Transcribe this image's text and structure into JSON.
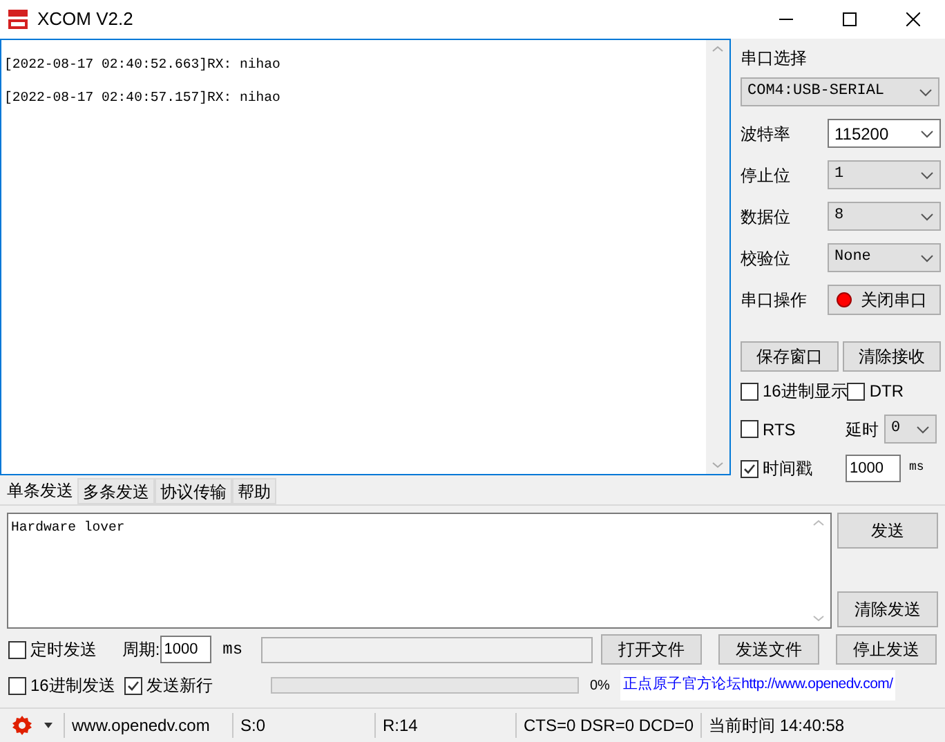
{
  "window": {
    "title": "XCOM V2.2"
  },
  "receive": {
    "lines": [
      "[2022-08-17 02:40:52.663]RX: nihao",
      "[2022-08-17 02:40:57.157]RX: nihao"
    ]
  },
  "port_panel": {
    "port_label": "串口选择",
    "port_value": "COM4:USB-SERIAL",
    "settings": [
      {
        "label": "波特率",
        "value": "115200",
        "kind": "combo"
      },
      {
        "label": "停止位",
        "value": "1",
        "kind": "select"
      },
      {
        "label": "数据位",
        "value": "8",
        "kind": "select"
      },
      {
        "label": "校验位",
        "value": "None",
        "kind": "select"
      }
    ],
    "operation_label": "串口操作",
    "operation_button": "关闭串口",
    "port_open": true,
    "buttons": [
      "保存窗口",
      "清除接收"
    ],
    "hex_display": {
      "label": "16进制显示",
      "checked": false
    },
    "dtr": {
      "label": "DTR",
      "checked": false
    },
    "rts": {
      "label": "RTS",
      "checked": false
    },
    "delay_label": "延时",
    "delay_value": "0",
    "timestamp": {
      "label": "时间戳",
      "checked": true
    },
    "timestamp_value": "1000",
    "timestamp_unit": "ms"
  },
  "tabs": [
    {
      "label": "单条发送",
      "selected": true
    },
    {
      "label": "多条发送",
      "selected": false
    },
    {
      "label": "协议传输",
      "selected": false
    },
    {
      "label": "帮助",
      "selected": false
    }
  ],
  "send": {
    "text": "Hardware lover",
    "send_button": "发送",
    "clear_button": "清除发送"
  },
  "bottom": {
    "timed_send": {
      "label": "定时发送",
      "checked": false
    },
    "period_label": "周期:",
    "period_value": "1000",
    "period_unit": "ms",
    "file_buttons": [
      "打开文件",
      "发送文件",
      "停止发送"
    ],
    "hex_send": {
      "label": "16进制发送",
      "checked": false
    },
    "send_newline": {
      "label": "发送新行",
      "checked": true
    },
    "progress": {
      "level": 0,
      "reading": "0%"
    },
    "link": "正点原子官方论坛http://www.openedv.com/"
  },
  "status_bar": {
    "segments": [
      "www.openedv.com",
      "S:0",
      "R:14",
      "CTS=0 DSR=0 DCD=0",
      "当前时间 14:40:58"
    ]
  }
}
